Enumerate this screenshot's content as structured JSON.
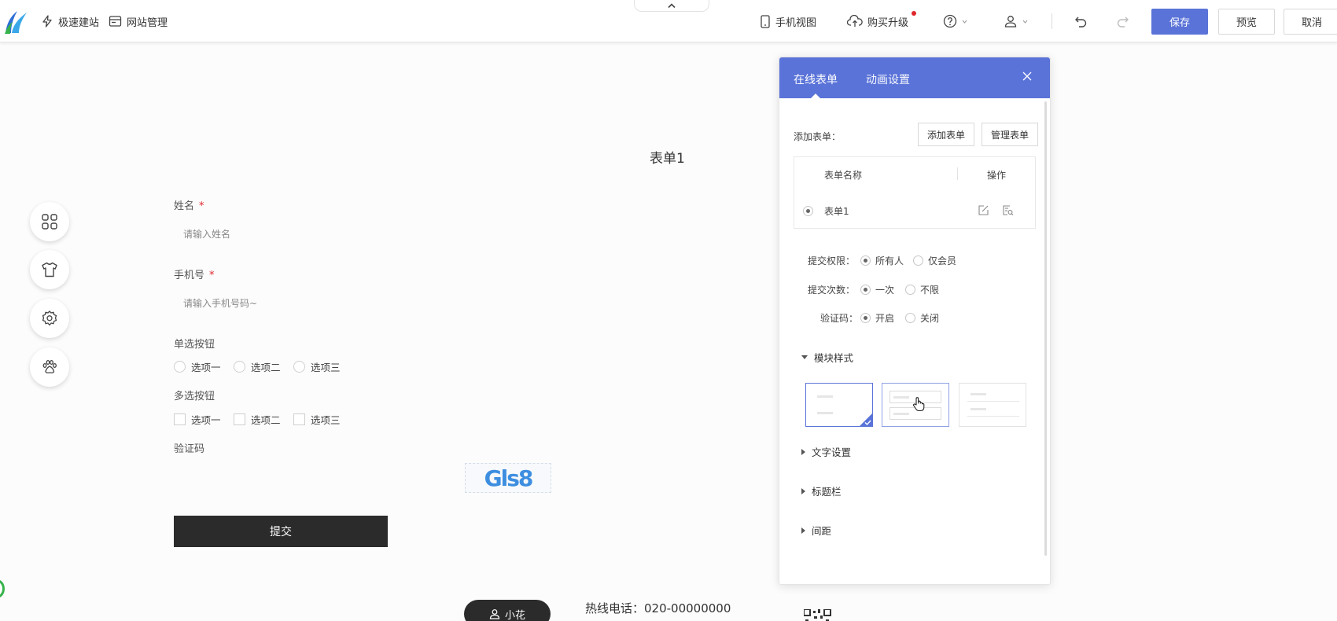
{
  "colors": {
    "accent": "#5a73d8",
    "required": "#e0262a",
    "submit_bg": "#2b2b2b"
  },
  "topbar": {
    "quick_build": "极速建站",
    "site_manage": "网站管理",
    "mobile_view": "手机视图",
    "upgrade": "购买升级",
    "save": "保存",
    "preview": "预览",
    "cancel": "取消",
    "icons": [
      "logo",
      "lightning-icon",
      "window-icon",
      "chevron-up-icon",
      "mobile-icon",
      "cloud-upload-icon",
      "help-icon",
      "user-icon",
      "undo-icon",
      "redo-icon"
    ]
  },
  "sidebar_tools": [
    "grid-icon",
    "shirt-icon",
    "gear-icon",
    "paw-icon"
  ],
  "form": {
    "title": "表单1",
    "name_label": "姓名",
    "name_placeholder": "请输入姓名",
    "phone_label": "手机号",
    "phone_placeholder": "请输入手机号码~",
    "required_mark": "*",
    "radio_label": "单选按钮",
    "radio_options": [
      "选项一",
      "选项二",
      "选项三"
    ],
    "checkbox_label": "多选按钮",
    "checkbox_options": [
      "选项一",
      "选项二",
      "选项三"
    ],
    "captcha_label": "验证码",
    "captcha_text": "Gls8",
    "submit": "提交"
  },
  "footer": {
    "contact_name": "小花",
    "hotline": "热线电话：020-00000000"
  },
  "panel": {
    "tabs": [
      "在线表单",
      "动画设置"
    ],
    "add_form_label": "添加表单：",
    "add_form_button": "添加表单",
    "manage_form_button": "管理表单",
    "table": {
      "headers": [
        "表单名称",
        "操作"
      ],
      "rows": [
        {
          "name": "表单1"
        }
      ]
    },
    "settings": [
      {
        "label": "提交权限：",
        "options": [
          "所有人",
          "仅会员"
        ],
        "selected": 0
      },
      {
        "label": "提交次数：",
        "options": [
          "一次",
          "不限"
        ],
        "selected": 0
      },
      {
        "label": "验证码：",
        "options": [
          "开启",
          "关闭"
        ],
        "selected": 0
      }
    ],
    "module_style": "模块样式",
    "sections": [
      "文字设置",
      "标题栏",
      "间距"
    ]
  }
}
